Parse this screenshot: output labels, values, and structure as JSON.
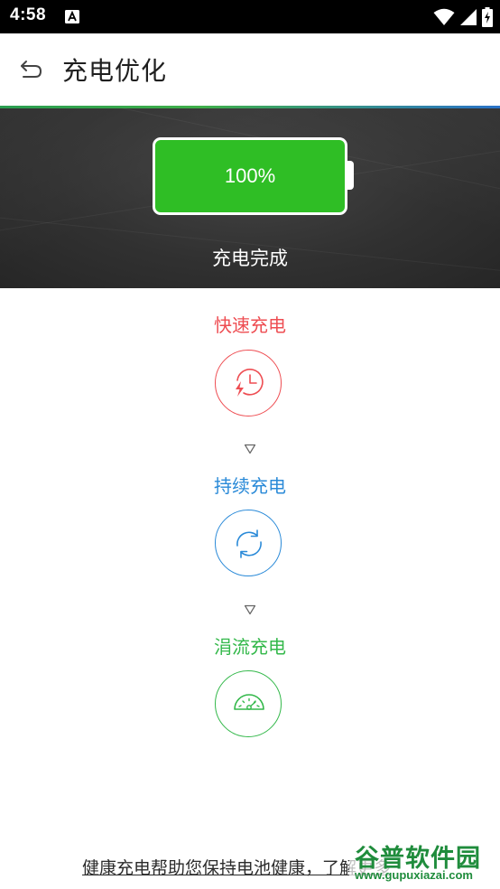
{
  "status_bar": {
    "time": "4:58",
    "notification_icon": "a-icon",
    "icons": [
      "wifi-icon",
      "signal-icon",
      "battery-icon"
    ]
  },
  "app_bar": {
    "back_icon": "back-arrow-icon",
    "title": "充电优化"
  },
  "battery": {
    "level_percent": 100,
    "level_text": "100%",
    "status_text": "充电完成",
    "fill_color": "#2fbe25"
  },
  "stages": [
    {
      "label": "快速充电",
      "icon": "fast-charge-clock-icon",
      "color": "#ee4d52"
    },
    {
      "label": "持续充电",
      "icon": "refresh-icon",
      "color": "#2a8ad8"
    },
    {
      "label": "涓流充电",
      "icon": "speedometer-icon",
      "color": "#33b84a"
    }
  ],
  "footer": {
    "link_text": "健康充电帮助您保持电池健康，了解更多"
  },
  "watermark": {
    "main_text": "谷普软件园",
    "url_text": "www.gupuxiazai.com"
  }
}
